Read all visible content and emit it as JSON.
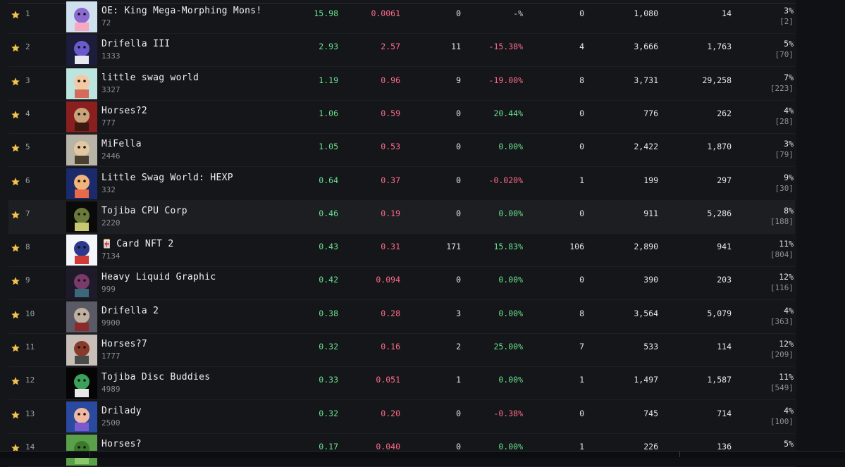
{
  "table": {
    "rows": [
      {
        "rank": "1",
        "name": "OE: King Mega-Morphing Mons!",
        "supply": "72",
        "floor": "15.98",
        "volume": "0.0061",
        "sales": "0",
        "change": "-%",
        "change_dir": "neutral",
        "listed": "0",
        "owners": "1,080",
        "holders": "14",
        "pct": "3%",
        "pct_sub": "[2]",
        "thumb": {
          "bg": "#cfe0ef",
          "fg": "#8b6bd1",
          "accent": "#f6a7c1"
        }
      },
      {
        "rank": "2",
        "name": "Drifella III",
        "supply": "1333",
        "floor": "2.93",
        "volume": "2.57",
        "sales": "11",
        "change": "-15.38%",
        "change_dir": "neg",
        "listed": "4",
        "owners": "3,666",
        "holders": "1,763",
        "pct": "5%",
        "pct_sub": "[70]",
        "thumb": {
          "bg": "#1b1d3a",
          "fg": "#6a5acd",
          "accent": "#e8e8f0"
        }
      },
      {
        "rank": "3",
        "name": "little swag world",
        "supply": "3327",
        "floor": "1.19",
        "volume": "0.96",
        "sales": "9",
        "change": "-19.00%",
        "change_dir": "neg",
        "listed": "8",
        "owners": "3,731",
        "holders": "29,258",
        "pct": "7%",
        "pct_sub": "[223]",
        "thumb": {
          "bg": "#bde5e0",
          "fg": "#f3c9a4",
          "accent": "#d46a5a"
        }
      },
      {
        "rank": "4",
        "name": "Horses?2",
        "supply": "777",
        "floor": "1.06",
        "volume": "0.59",
        "sales": "0",
        "change": "20.44%",
        "change_dir": "pos",
        "listed": "0",
        "owners": "776",
        "holders": "262",
        "pct": "4%",
        "pct_sub": "[28]",
        "thumb": {
          "bg": "#8a1f1f",
          "fg": "#c9a47a",
          "accent": "#3b1a12"
        }
      },
      {
        "rank": "5",
        "name": "MiFella",
        "supply": "2446",
        "floor": "1.05",
        "volume": "0.53",
        "sales": "0",
        "change": "0.00%",
        "change_dir": "pos",
        "listed": "0",
        "owners": "2,422",
        "holders": "1,870",
        "pct": "3%",
        "pct_sub": "[79]",
        "thumb": {
          "bg": "#b9b4a8",
          "fg": "#e2c7a0",
          "accent": "#4a4030"
        }
      },
      {
        "rank": "6",
        "name": "Little Swag World: HEXP",
        "supply": "332",
        "floor": "0.64",
        "volume": "0.37",
        "sales": "0",
        "change": "-0.020%",
        "change_dir": "neg",
        "listed": "1",
        "owners": "199",
        "holders": "297",
        "pct": "9%",
        "pct_sub": "[30]",
        "thumb": {
          "bg": "#1a2a6a",
          "fg": "#f2b37a",
          "accent": "#e86a4a"
        }
      },
      {
        "rank": "7",
        "name": "Tojiba CPU Corp",
        "supply": "2220",
        "floor": "0.46",
        "volume": "0.19",
        "sales": "0",
        "change": "0.00%",
        "change_dir": "pos",
        "listed": "0",
        "owners": "911",
        "holders": "5,286",
        "pct": "8%",
        "pct_sub": "[188]",
        "thumb": {
          "bg": "#0a0a0a",
          "fg": "#6b7a3a",
          "accent": "#c8c870"
        }
      },
      {
        "rank": "8",
        "name": "Card NFT 2",
        "name_icon": "🀄",
        "supply": "7134",
        "floor": "0.43",
        "volume": "0.31",
        "sales": "171",
        "change": "15.83%",
        "change_dir": "pos",
        "listed": "106",
        "owners": "2,890",
        "holders": "941",
        "pct": "11%",
        "pct_sub": "[804]",
        "thumb": {
          "bg": "#f4f6fa",
          "fg": "#2b3a8c",
          "accent": "#d23a3a"
        }
      },
      {
        "rank": "9",
        "name": "Heavy Liquid Graphic",
        "supply": "999",
        "floor": "0.42",
        "volume": "0.094",
        "sales": "0",
        "change": "0.00%",
        "change_dir": "pos",
        "listed": "0",
        "owners": "390",
        "holders": "203",
        "pct": "12%",
        "pct_sub": "[116]",
        "thumb": {
          "bg": "#1e1a2a",
          "fg": "#7a3a6a",
          "accent": "#3a6a7a"
        }
      },
      {
        "rank": "10",
        "name": "Drifella 2",
        "supply": "9900",
        "floor": "0.38",
        "volume": "0.28",
        "sales": "3",
        "change": "0.00%",
        "change_dir": "pos",
        "listed": "8",
        "owners": "3,564",
        "holders": "5,079",
        "pct": "4%",
        "pct_sub": "[363]",
        "thumb": {
          "bg": "#5a5a66",
          "fg": "#c0b0a0",
          "accent": "#8a2a2a"
        }
      },
      {
        "rank": "11",
        "name": "Horses?7",
        "supply": "1777",
        "floor": "0.32",
        "volume": "0.16",
        "sales": "2",
        "change": "25.00%",
        "change_dir": "pos",
        "listed": "7",
        "owners": "533",
        "holders": "114",
        "pct": "12%",
        "pct_sub": "[209]",
        "thumb": {
          "bg": "#c8c0b8",
          "fg": "#8a3a2a",
          "accent": "#4a4a4a"
        }
      },
      {
        "rank": "12",
        "name": "Tojiba Disc Buddies",
        "supply": "4989",
        "floor": "0.33",
        "volume": "0.051",
        "sales": "1",
        "change": "0.00%",
        "change_dir": "pos",
        "listed": "1",
        "owners": "1,497",
        "holders": "1,587",
        "pct": "11%",
        "pct_sub": "[549]",
        "thumb": {
          "bg": "#050505",
          "fg": "#3aa05a",
          "accent": "#e8e8e8"
        }
      },
      {
        "rank": "13",
        "name": "Drilady",
        "supply": "2500",
        "floor": "0.32",
        "volume": "0.20",
        "sales": "0",
        "change": "-0.38%",
        "change_dir": "neg",
        "listed": "0",
        "owners": "745",
        "holders": "714",
        "pct": "4%",
        "pct_sub": "[100]",
        "thumb": {
          "bg": "#2a4aa0",
          "fg": "#f0b8a0",
          "accent": "#7a5acd"
        }
      },
      {
        "rank": "14",
        "name": "Horses?",
        "supply": "",
        "floor": "0.17",
        "volume": "0.040",
        "sales": "0",
        "change": "0.00%",
        "change_dir": "pos",
        "listed": "1",
        "owners": "226",
        "holders": "136",
        "pct": "5%",
        "pct_sub": "",
        "thumb": {
          "bg": "#5aa04a",
          "fg": "#3a7a2a",
          "accent": "#8ac86a"
        }
      }
    ]
  },
  "colors": {
    "star": "#f2c14e",
    "positive": "#67e38f",
    "negative": "#ff6b88"
  }
}
